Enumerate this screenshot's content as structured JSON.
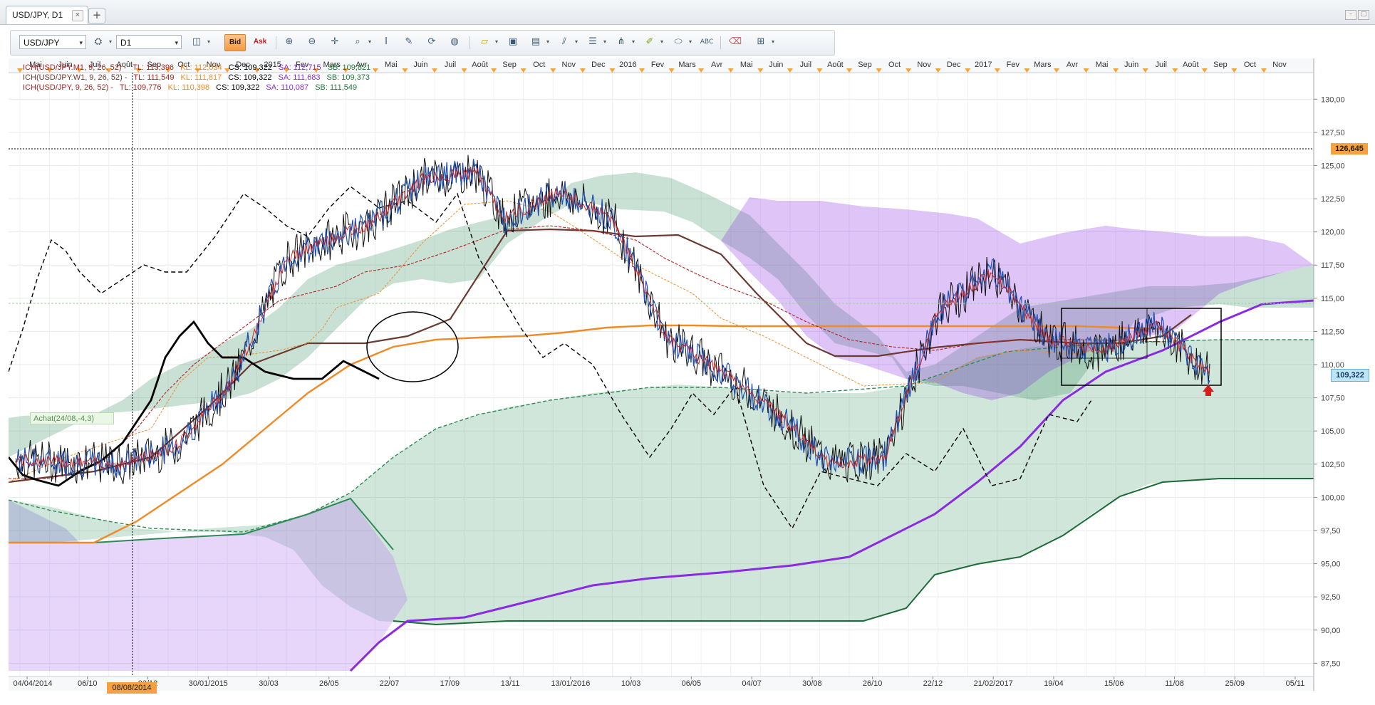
{
  "tab": {
    "title": "USD/JPY, D1",
    "close": "×",
    "add": "+"
  },
  "window_controls": {
    "minimize": "–",
    "restore": "□"
  },
  "toolbar": {
    "symbol": "USD/JPY",
    "timeframe": "D1",
    "bid_label": "Bid",
    "ask_label": "Ask",
    "dropdown_glyph": "▾"
  },
  "legend": [
    {
      "label": "ICH(USD/JPY.M1, 9, 26, 52) -",
      "tl": "TL: 113,396",
      "kl": "KL: 112,034",
      "cs": "CS: 109,322",
      "sa": "SA: 112,715",
      "sb": "SB: 109,821"
    },
    {
      "label": "ICH(USD/JPY.W1, 9, 26, 52) -",
      "tl": "TL: 111,549",
      "kl": "KL: 111,817",
      "cs": "CS: 109,322",
      "sa": "SA: 111,683",
      "sb": "SB: 109,373"
    },
    {
      "label": "ICH(USD/JPY, 9, 26, 52) -",
      "tl": "TL: 109,776",
      "kl": "KL: 110,398",
      "cs": "CS: 109,322",
      "sa": "SA: 110,087",
      "sb": "SB: 111,549"
    }
  ],
  "colors": {
    "tl": "#b22222",
    "kl": "#f08a24",
    "cs": "#000000",
    "sa": "#8a2be2",
    "sb": "#1f7a3a"
  },
  "price_labels": {
    "crosshair": "126,645",
    "current": "109,322"
  },
  "achat_label": "Achat(24/08,-4,3)",
  "crosshair_date": "08/08/2014",
  "chart_data": {
    "type": "line",
    "title": "USD/JPY, D1",
    "y_ticks": [
      "130,00",
      "127,50",
      "125,00",
      "122,50",
      "120,00",
      "117,50",
      "115,00",
      "112,50",
      "110,00",
      "107,50",
      "105,00",
      "102,50",
      "100,00",
      "97,50",
      "95,00",
      "92,50",
      "90,00",
      "87,50"
    ],
    "ylim": [
      86.5,
      132
    ],
    "month_labels": [
      "Mai",
      "Juin",
      "Juil",
      "Août",
      "Sep",
      "Oct",
      "Nov",
      "Dec",
      "2015",
      "Fev",
      "Mars",
      "Avr",
      "Mai",
      "Juin",
      "Juil",
      "Août",
      "Sep",
      "Oct",
      "Nov",
      "Dec",
      "2016",
      "Fev",
      "Mars",
      "Avr",
      "Mai",
      "Juin",
      "Juil",
      "Août",
      "Sep",
      "Oct",
      "Nov",
      "Dec",
      "2017",
      "Fev",
      "Mars",
      "Avr",
      "Mai",
      "Juin",
      "Juil",
      "Août",
      "Sep",
      "Oct",
      "Nov"
    ],
    "date_labels": [
      "04/04/2014",
      "06/10",
      "02/12",
      "30/01/2015",
      "30/03",
      "26/05",
      "22/07",
      "17/09",
      "13/11",
      "13/01/2016",
      "10/03",
      "06/05",
      "04/07",
      "30/08",
      "26/10",
      "22/12",
      "21/02/2017",
      "19/04",
      "15/06",
      "11/08",
      "25/09",
      "05/11"
    ],
    "crosshair_price": 126.645,
    "current_price": 109.322,
    "series": [
      {
        "name": "ICH(USD/JPY.M1, 9, 26, 52)",
        "kind": "tenkan",
        "values": [
          [
            0,
            102.6
          ],
          [
            8,
            104.5
          ],
          [
            14,
            108.5
          ],
          [
            18,
            113
          ],
          [
            22,
            116.5
          ],
          [
            27,
            115.6
          ],
          [
            33,
            113.4
          ],
          [
            38,
            114
          ],
          [
            42,
            111.5
          ],
          [
            46,
            112
          ]
        ]
      },
      {
        "name": "ICH(USD/JPY.W1, 9, 26, 52)",
        "kind": "kijun",
        "values": [
          [
            0,
            101.2
          ],
          [
            6,
            102
          ],
          [
            12,
            108
          ],
          [
            18,
            113.5
          ],
          [
            24,
            120.5
          ],
          [
            30,
            120.8
          ],
          [
            35,
            114.5
          ],
          [
            38,
            111.5
          ],
          [
            42,
            112.5
          ],
          [
            46,
            112.2
          ]
        ]
      },
      {
        "name": "ICH(USD/JPY, 9, 26, 52)",
        "kind": "price",
        "values": [
          [
            0,
            102.8
          ],
          [
            4,
            102.5
          ],
          [
            6,
            104
          ],
          [
            8,
            108.8
          ],
          [
            10,
            118
          ],
          [
            12,
            119.8
          ],
          [
            13,
            120.5
          ],
          [
            15,
            124
          ],
          [
            17,
            124.5
          ],
          [
            18,
            121
          ],
          [
            20,
            123
          ],
          [
            22,
            121
          ],
          [
            24,
            112
          ],
          [
            26,
            109.5
          ],
          [
            28,
            106.5
          ],
          [
            30,
            102.5
          ],
          [
            32,
            103
          ],
          [
            34,
            114
          ],
          [
            36,
            117
          ],
          [
            38,
            112
          ],
          [
            40,
            111
          ],
          [
            42,
            113
          ],
          [
            44,
            109.3
          ]
        ]
      }
    ]
  }
}
